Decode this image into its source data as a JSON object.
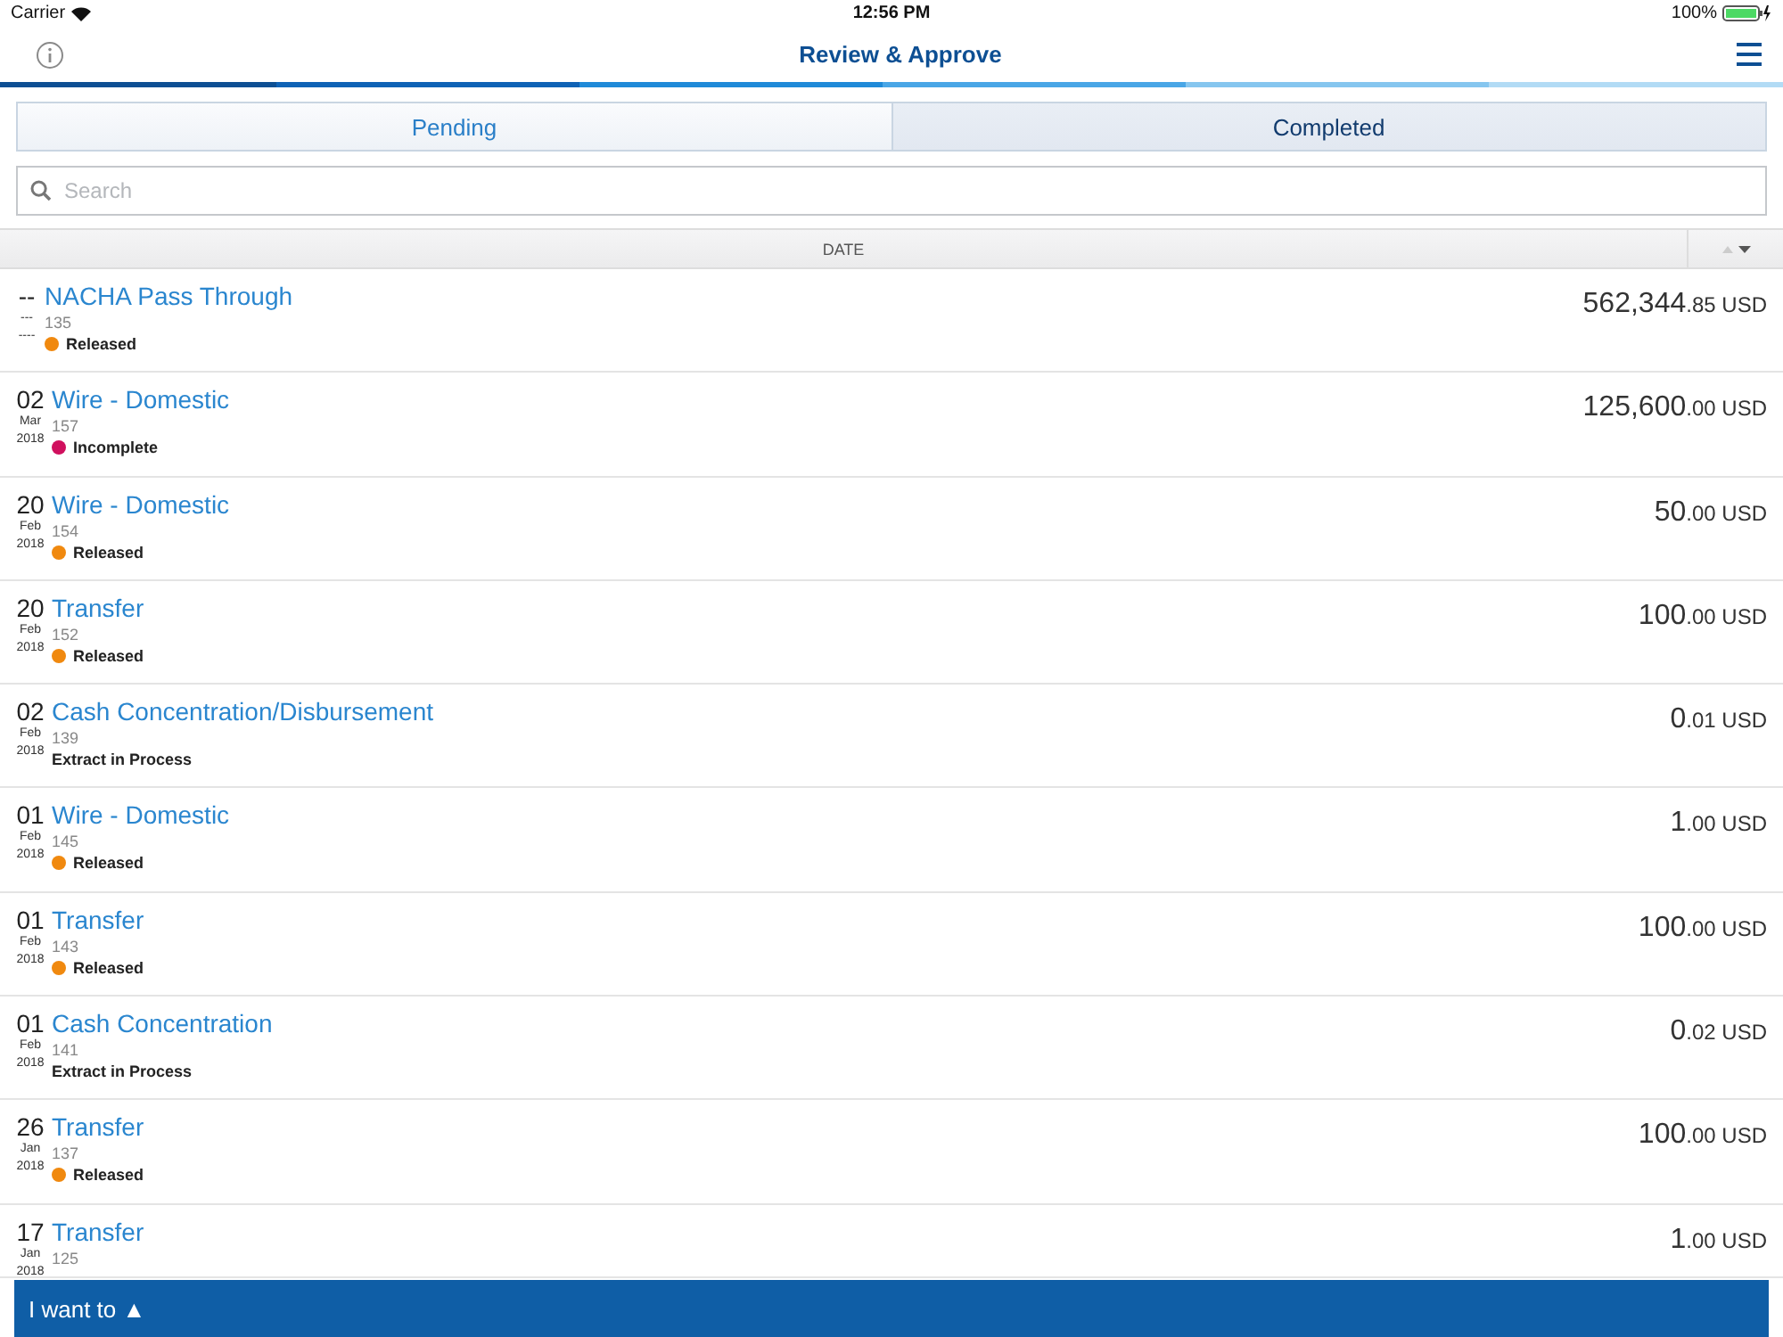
{
  "status_bar": {
    "carrier": "Carrier",
    "time": "12:56 PM",
    "battery": "100%"
  },
  "header": {
    "title": "Review & Approve"
  },
  "tabs": [
    {
      "label": "Pending",
      "selected": false
    },
    {
      "label": "Completed",
      "selected": true
    }
  ],
  "search": {
    "placeholder": "Search"
  },
  "list_header": {
    "column": "DATE"
  },
  "rows": [
    {
      "day": "--",
      "month": "---",
      "year": "----",
      "title": "NACHA Pass Through",
      "number": "135",
      "status": "Released",
      "color": "#f0890f",
      "whole": "562,344",
      "cents": ".85",
      "currency": "USD"
    },
    {
      "day": "02",
      "month": "Mar",
      "year": "2018",
      "title": "Wire - Domestic",
      "number": "157",
      "status": "Incomplete",
      "color": "#d0105e",
      "whole": "125,600",
      "cents": ".00",
      "currency": "USD"
    },
    {
      "day": "20",
      "month": "Feb",
      "year": "2018",
      "title": "Wire - Domestic",
      "number": "154",
      "status": "Released",
      "color": "#f0890f",
      "whole": "50",
      "cents": ".00",
      "currency": "USD"
    },
    {
      "day": "20",
      "month": "Feb",
      "year": "2018",
      "title": "Transfer",
      "number": "152",
      "status": "Released",
      "color": "#f0890f",
      "whole": "100",
      "cents": ".00",
      "currency": "USD"
    },
    {
      "day": "02",
      "month": "Feb",
      "year": "2018",
      "title": "Cash Concentration/Disbursement",
      "number": "139",
      "status": "Extract in Process",
      "whole": "0",
      "cents": ".01",
      "currency": "USD"
    },
    {
      "day": "01",
      "month": "Feb",
      "year": "2018",
      "title": "Wire - Domestic",
      "number": "145",
      "status": "Released",
      "color": "#f0890f",
      "whole": "1",
      "cents": ".00",
      "currency": "USD"
    },
    {
      "day": "01",
      "month": "Feb",
      "year": "2018",
      "title": "Transfer",
      "number": "143",
      "status": "Released",
      "color": "#f0890f",
      "whole": "100",
      "cents": ".00",
      "currency": "USD"
    },
    {
      "day": "01",
      "month": "Feb",
      "year": "2018",
      "title": "Cash Concentration",
      "number": "141",
      "status": "Extract in Process",
      "whole": "0",
      "cents": ".02",
      "currency": "USD"
    },
    {
      "day": "26",
      "month": "Jan",
      "year": "2018",
      "title": "Transfer",
      "number": "137",
      "status": "Released",
      "color": "#f0890f",
      "whole": "100",
      "cents": ".00",
      "currency": "USD"
    },
    {
      "day": "17",
      "month": "Jan",
      "year": "2018",
      "title": "Transfer",
      "number": "125",
      "whole": "1",
      "cents": ".00",
      "currency": "USD"
    }
  ],
  "action_bar": {
    "label": "I want to ▲"
  }
}
